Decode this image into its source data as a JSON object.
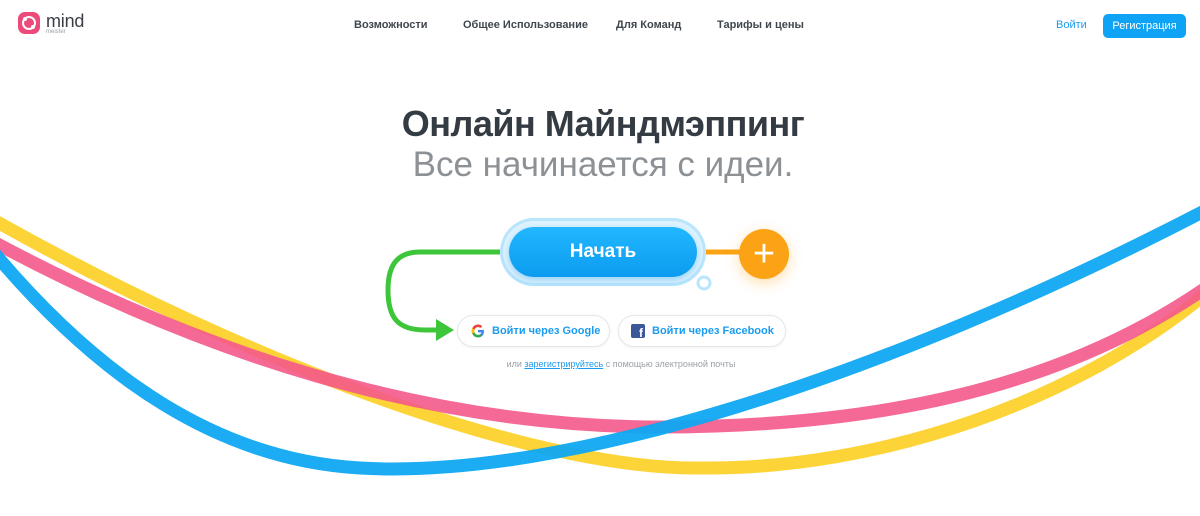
{
  "header": {
    "logo_word": "mind",
    "logo_sub": "meister",
    "nav": [
      "Возможности",
      "Общее Использование",
      "Для Команд",
      "Тарифы и цены"
    ],
    "login_label": "Войти",
    "register_label": "Регистрация"
  },
  "hero": {
    "title": "Онлайн Майндмэппинг",
    "subtitle": "Все начинается с идеи."
  },
  "actions": {
    "start_label": "Начать",
    "plus_icon": "plus-icon",
    "google_label": "Войти через Google",
    "facebook_label": "Войти через Facebook",
    "email_prefix": "или",
    "email_link": "зарегистрируйтесь",
    "email_suffix": "с помощью электронной почты"
  },
  "colors": {
    "brand_pink": "#ec4b7a",
    "accent_blue": "#0ea3f4",
    "orange": "#fba314",
    "green": "#3ec63a",
    "curve_yellow": "#fdd22d",
    "curve_pink": "#f4598b",
    "curve_blue": "#0fa8f2"
  }
}
